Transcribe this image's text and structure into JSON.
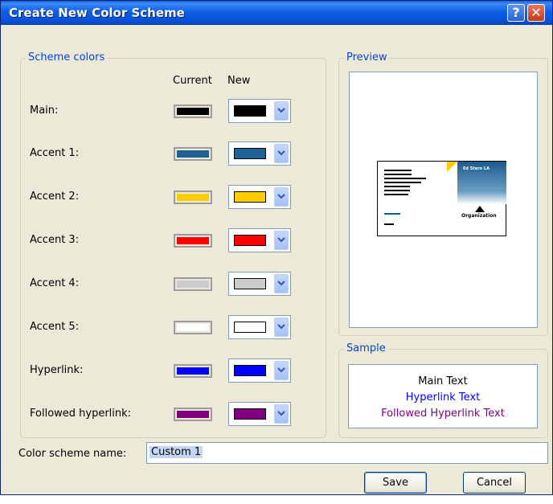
{
  "window": {
    "title": "Create New Color Scheme",
    "help_glyph": "?",
    "close_glyph": "✕"
  },
  "scheme": {
    "legend": "Scheme colors",
    "col_current": "Current",
    "col_new": "New",
    "rows": [
      {
        "label": "Main:",
        "color": "#000000"
      },
      {
        "label": "Accent 1:",
        "color": "#1d6195"
      },
      {
        "label": "Accent 2:",
        "color": "#ffcc00"
      },
      {
        "label": "Accent 3:",
        "color": "#ff0000"
      },
      {
        "label": "Accent 4:",
        "color": "#cccccc"
      },
      {
        "label": "Accent 5:",
        "color": "#ffffff"
      },
      {
        "label": "Hyperlink:",
        "color": "#0000ff"
      },
      {
        "label": "Followed hyperlink:",
        "color": "#800080"
      }
    ]
  },
  "preview": {
    "legend": "Preview",
    "card_company": "Ed Stern LA",
    "card_org": "Organization"
  },
  "sample": {
    "legend": "Sample",
    "main_text": "Main Text",
    "hyperlink_text": "Hyperlink Text",
    "followed_text": "Followed Hyperlink Text",
    "main_color": "#000000",
    "hyperlink_color": "#0000ff",
    "followed_color": "#800080"
  },
  "name_field": {
    "label": "Color scheme name:",
    "value": "Custom 1"
  },
  "buttons": {
    "save": "Save",
    "cancel": "Cancel"
  }
}
